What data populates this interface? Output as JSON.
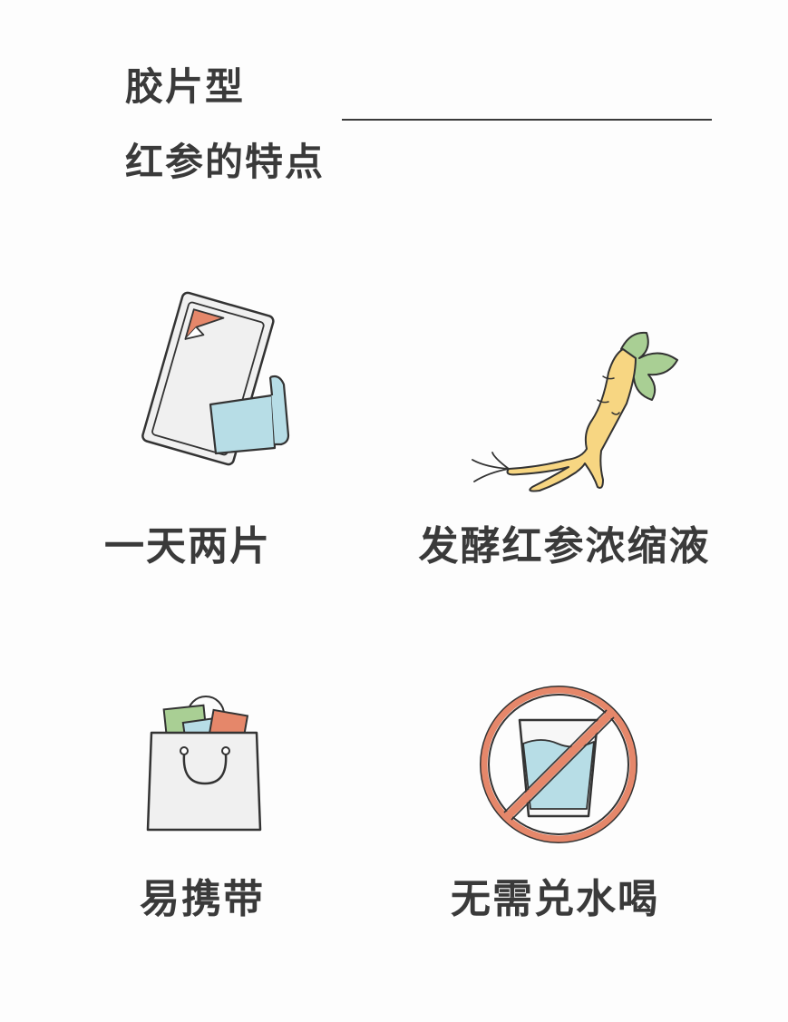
{
  "header": {
    "title_line1": "胶片型",
    "title_line2": "红参的特点"
  },
  "features": [
    {
      "label": "一天两片",
      "icon": "film-packet-icon"
    },
    {
      "label": "发酵红参浓缩液",
      "icon": "ginseng-root-icon"
    },
    {
      "label": "易携带",
      "icon": "shopping-bag-icon"
    },
    {
      "label": "无需兑水喝",
      "icon": "no-water-icon"
    }
  ],
  "colors": {
    "text": "#3a3a3a",
    "outline": "#333333",
    "light_blue": "#b7dde6",
    "orange": "#e5876a",
    "green": "#a9cf94",
    "ginseng_yellow": "#f7d682",
    "panel_gray": "#f0f0f0"
  }
}
